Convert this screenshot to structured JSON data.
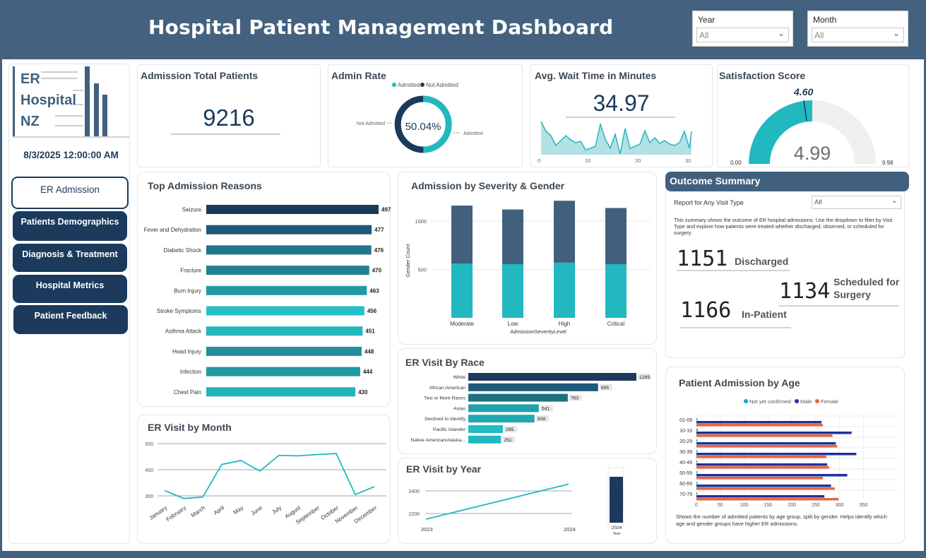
{
  "header": {
    "title": "Hospital Patient Management Dashboard"
  },
  "slicers": {
    "year": {
      "label": "Year",
      "value": "All"
    },
    "month": {
      "label": "Month",
      "value": "All"
    }
  },
  "logo": {
    "line1": "ER",
    "line2": "Hospital",
    "line3": "NZ"
  },
  "timestamp": "8/3/2025 12:00:00 AM",
  "nav": [
    {
      "label": "ER Admission",
      "active": true
    },
    {
      "label": "Patients Demographics"
    },
    {
      "label": "Diagnosis & Treatment"
    },
    {
      "label": "Hospital Metrics"
    },
    {
      "label": "Patient Feedback"
    }
  ],
  "kpi": {
    "admission_title": "Admission Total Patients",
    "admission_value": "9216",
    "admin_rate_title": "Admin Rate",
    "admin_rate_legend": [
      "Admitted",
      "Not Admitted"
    ],
    "admin_rate_center": "50.04%",
    "admin_rate_left_label": "Not Admitted",
    "admin_rate_right_label": "Admitted",
    "wait_title": "Avg. Wait Time  in Minutes",
    "wait_value": "34.97",
    "wait_axis": [
      "0",
      "10",
      "20",
      "30"
    ],
    "satisfaction_title": "Satisfaction Score",
    "satisfaction_value": "4.99",
    "satisfaction_target": "4.60",
    "satisfaction_min": "0.00",
    "satisfaction_max": "9.98"
  },
  "outcome": {
    "title": "Outcome Summary",
    "filter_label": "Report for Any Visit Type",
    "filter_value": "All",
    "description": "This summary shows the outcome of ER hospital admissions. Use the dropdown to filter by Visit Type and explore how patients were treated whether discharged, observed, or scheduled for surgery.",
    "discharged_value": "1151",
    "discharged_label": "Discharged",
    "surgery_value": "1134",
    "surgery_label1": "Scheduled for",
    "surgery_label2": "Surgery",
    "inpatient_value": "1166",
    "inpatient_label": "In-Patient"
  },
  "colors": {
    "navy": "#1b3a5c",
    "teal": "#22b8c0",
    "slate": "#41607e",
    "orange": "#e8673c",
    "blue": "#1f2f9c",
    "sky": "#1ea0e0"
  },
  "chart_data": [
    {
      "id": "reasons",
      "type": "bar",
      "orientation": "horizontal",
      "title": "Top Admission Reasons",
      "categories": [
        "Seizure",
        "Fever and Dehydration",
        "Diabetic Shock",
        "Fracture",
        "Burn Injury",
        "Stroke Symptoms",
        "Asthma Attack",
        "Head Injury",
        "Infection",
        "Chest Pain"
      ],
      "values": [
        497,
        477,
        476,
        470,
        463,
        456,
        451,
        448,
        444,
        430
      ]
    },
    {
      "id": "severity",
      "type": "bar",
      "stacked": true,
      "title": "Admission by Severity & Gender",
      "xlabel": "AdmissionSeverityLevel",
      "ylabel": "Gender Count",
      "categories": [
        "Moderate",
        "Low",
        "High",
        "Critical"
      ],
      "yticks": [
        "500",
        "1000"
      ],
      "series": [
        {
          "values": [
            560,
            555,
            570,
            555
          ]
        },
        {
          "values": [
            600,
            565,
            640,
            580
          ]
        }
      ],
      "ylim": [
        0,
        1250
      ]
    },
    {
      "id": "race",
      "type": "bar",
      "orientation": "horizontal",
      "title": "ER Visit By Race",
      "categories": [
        "White",
        "African American",
        "Two or More Races",
        "Asian",
        "Declined to Identify",
        "Pacific Islander",
        "Native American/Alaska..."
      ],
      "values": [
        1289,
        995,
        763,
        541,
        508,
        265,
        251
      ]
    },
    {
      "id": "month",
      "type": "line",
      "title": "ER Visit by Month",
      "categories": [
        "January",
        "February",
        "March",
        "April",
        "May",
        "June",
        "July",
        "August",
        "September",
        "October",
        "November",
        "December"
      ],
      "values": [
        320,
        290,
        295,
        420,
        435,
        395,
        455,
        453,
        458,
        462,
        305,
        335
      ],
      "ylim": [
        280,
        500
      ],
      "yticks": [
        "300",
        "400",
        "500"
      ]
    },
    {
      "id": "year",
      "type": "line",
      "title": "ER Visit by Year",
      "categories": [
        "2023",
        "2024"
      ],
      "values": [
        2150,
        2460
      ],
      "yticks": [
        "2200",
        "2400"
      ],
      "bar_category": "2024",
      "bar_axis_label": "Year"
    },
    {
      "id": "age",
      "type": "bar",
      "orientation": "horizontal",
      "title": "Patient Admission by Age",
      "legend": [
        "Not yet confirmed",
        "Male",
        "Female"
      ],
      "categories": [
        "01-09",
        "10-19",
        "20-29",
        "30-39",
        "40-49",
        "50-59",
        "60-69",
        "70-79"
      ],
      "xticks": [
        "0",
        "50",
        "100",
        "150",
        "200",
        "250",
        "300",
        "350"
      ],
      "series": [
        {
          "name": "Not yet confirmed",
          "values": [
            2,
            3,
            2,
            2,
            2,
            2,
            2,
            2
          ]
        },
        {
          "name": "Male",
          "values": [
            262,
            325,
            292,
            335,
            274,
            316,
            282,
            268
          ]
        },
        {
          "name": "Female",
          "values": [
            265,
            285,
            295,
            272,
            278,
            265,
            290,
            298
          ]
        }
      ],
      "xlim": [
        0,
        350
      ],
      "note": "Shows the number of admitted patients by age group, split by gender. Helps identify which age and gender groups have higher ER admissions."
    }
  ]
}
